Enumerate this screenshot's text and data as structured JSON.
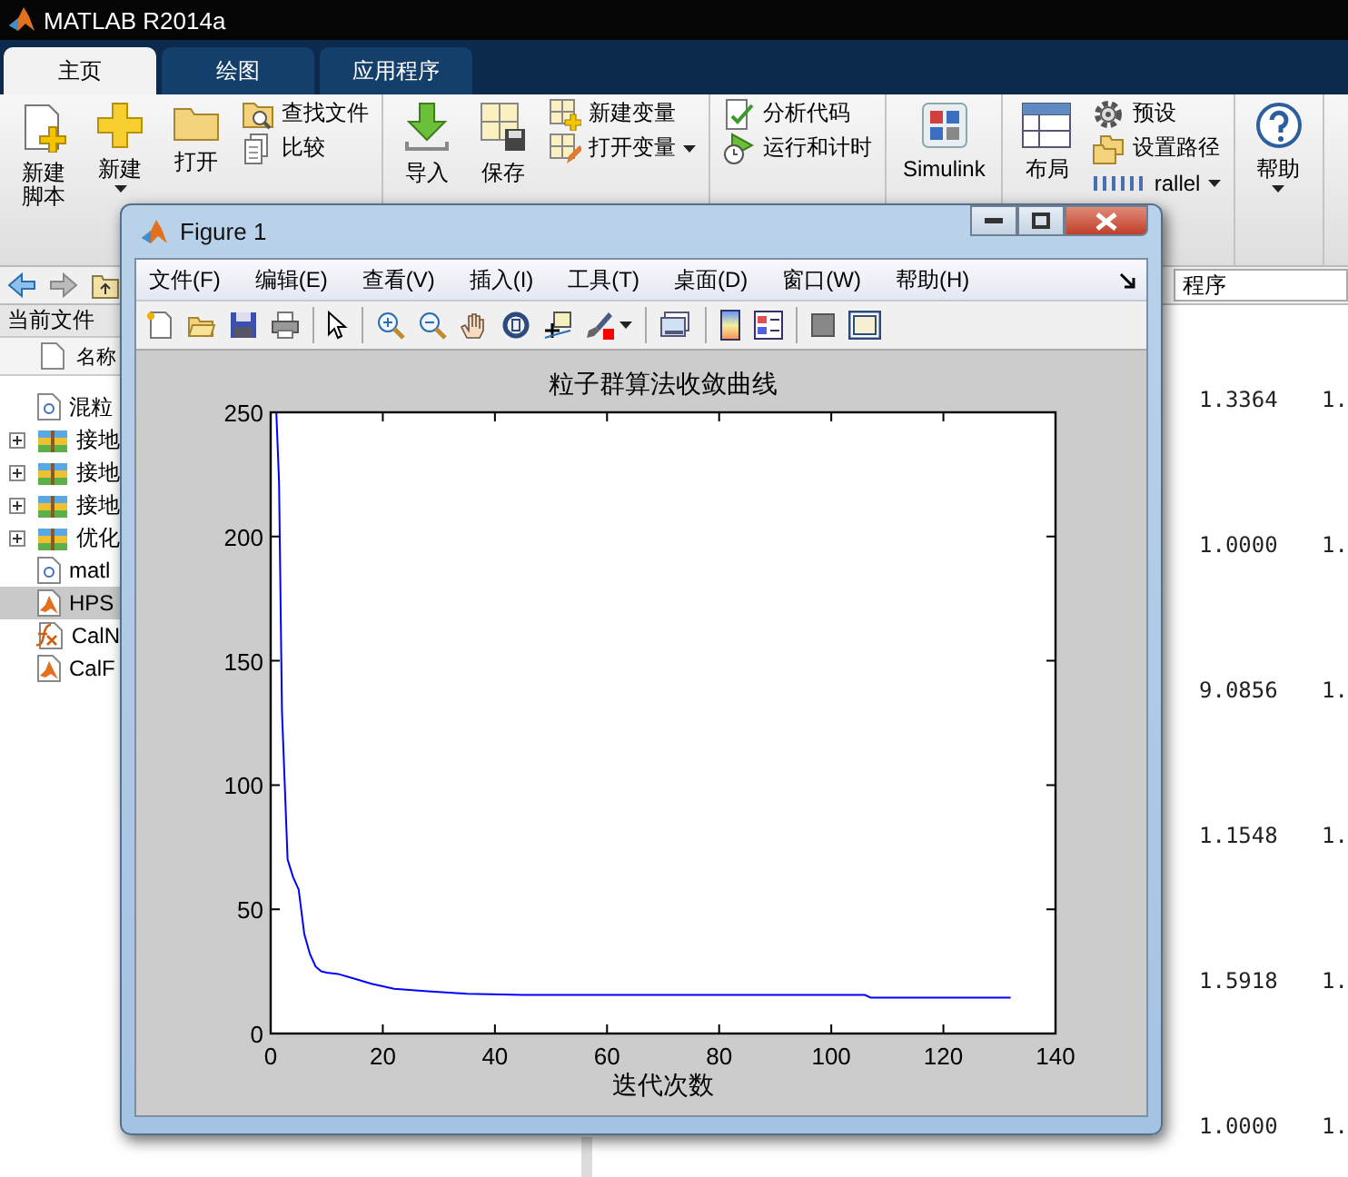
{
  "app": {
    "title": "MATLAB R2014a"
  },
  "tabs": [
    {
      "label": "主页",
      "selected": true
    },
    {
      "label": "绘图",
      "selected": false
    },
    {
      "label": "应用程序",
      "selected": false
    }
  ],
  "toolstrip": [
    {
      "items": [
        {
          "kind": "large",
          "lines": [
            "新建",
            "脚本"
          ],
          "menu": false
        },
        {
          "kind": "large",
          "lines": [
            "新建"
          ],
          "menu": true
        },
        {
          "kind": "large",
          "lines": [
            "打开"
          ],
          "menu": false
        },
        {
          "kind": "stack",
          "rows": [
            {
              "label": "查找文件",
              "menu": false
            },
            {
              "label": "比较",
              "menu": false
            }
          ]
        }
      ]
    },
    {
      "items": [
        {
          "kind": "large",
          "lines": [
            "导入"
          ],
          "menu": false
        },
        {
          "kind": "large",
          "lines": [
            "保存"
          ],
          "menu": false
        },
        {
          "kind": "stack",
          "rows": [
            {
              "label": "新建变量",
              "menu": false
            },
            {
              "label": "打开变量",
              "menu": true
            }
          ]
        }
      ]
    },
    {
      "items": [
        {
          "kind": "stack",
          "rows": [
            {
              "label": "分析代码",
              "menu": false
            },
            {
              "label": "运行和计时",
              "menu": false
            }
          ]
        }
      ]
    },
    {
      "items": [
        {
          "kind": "large",
          "lines": [
            "Simulink"
          ],
          "menu": false
        }
      ]
    },
    {
      "items": [
        {
          "kind": "large",
          "lines": [
            "布局"
          ],
          "menu": false
        },
        {
          "kind": "stack",
          "rows": [
            {
              "label": "预设",
              "menu": false
            },
            {
              "label": "设置路径",
              "menu": false
            },
            {
              "label": "rallel",
              "menu": true
            }
          ]
        }
      ]
    },
    {
      "items": [
        {
          "kind": "large",
          "lines": [
            "帮助"
          ],
          "menu": true
        }
      ]
    }
  ],
  "address": {
    "value": "程序"
  },
  "current_folder": {
    "title": "当前文件",
    "column": "名称",
    "files": [
      {
        "name": "混粒",
        "kind": "text",
        "expandable": false,
        "selected": false
      },
      {
        "name": "接地",
        "kind": "package",
        "expandable": true,
        "selected": false
      },
      {
        "name": "接地",
        "kind": "package",
        "expandable": true,
        "selected": false
      },
      {
        "name": "接地",
        "kind": "package",
        "expandable": true,
        "selected": false
      },
      {
        "name": "优化",
        "kind": "package",
        "expandable": true,
        "selected": false
      },
      {
        "name": "matl",
        "kind": "text",
        "expandable": false,
        "selected": false
      },
      {
        "name": "HPS",
        "kind": "matlab",
        "expandable": false,
        "selected": true
      },
      {
        "name": "CalN",
        "kind": "function",
        "expandable": false,
        "selected": false
      },
      {
        "name": "CalF",
        "kind": "matlab",
        "expandable": false,
        "selected": false
      }
    ]
  },
  "command_window": {
    "rows": [
      [
        "1.3364",
        "1."
      ],
      [
        "1.0000",
        "1."
      ],
      [
        "9.0856",
        "1."
      ],
      [
        "1.1548",
        "1."
      ],
      [
        "1.5918",
        "1."
      ],
      [
        "1.0000",
        "1."
      ]
    ]
  },
  "figure": {
    "title": "Figure 1",
    "menus": [
      "文件(F)",
      "编辑(E)",
      "查看(V)",
      "插入(I)",
      "工具(T)",
      "桌面(D)",
      "窗口(W)",
      "帮助(H)"
    ],
    "plot": {
      "chart_data": {
        "type": "line",
        "title": "粒子群算法收敛曲线",
        "xlabel": "迭代次数",
        "x": [
          1,
          1.5,
          2,
          3,
          4,
          5,
          6,
          7,
          8,
          9,
          10,
          12,
          15,
          18,
          22,
          28,
          35,
          45,
          60,
          80,
          106,
          107,
          120,
          132
        ],
        "series": [
          {
            "color": "#0000ff",
            "values": [
              250,
              222,
              130,
              70,
              63,
              58,
              40,
              32,
              27,
              25,
              24.5,
              24,
              22,
              20,
              18,
              17,
              16,
              15.5,
              15.5,
              15.5,
              15.5,
              14.5,
              14.5,
              14.5
            ]
          }
        ],
        "xlim": [
          0,
          140
        ],
        "ylim": [
          0,
          250
        ],
        "xticks": [
          0,
          20,
          40,
          60,
          80,
          100,
          120,
          140
        ],
        "yticks": [
          0,
          50,
          100,
          150,
          200,
          250
        ]
      }
    }
  }
}
